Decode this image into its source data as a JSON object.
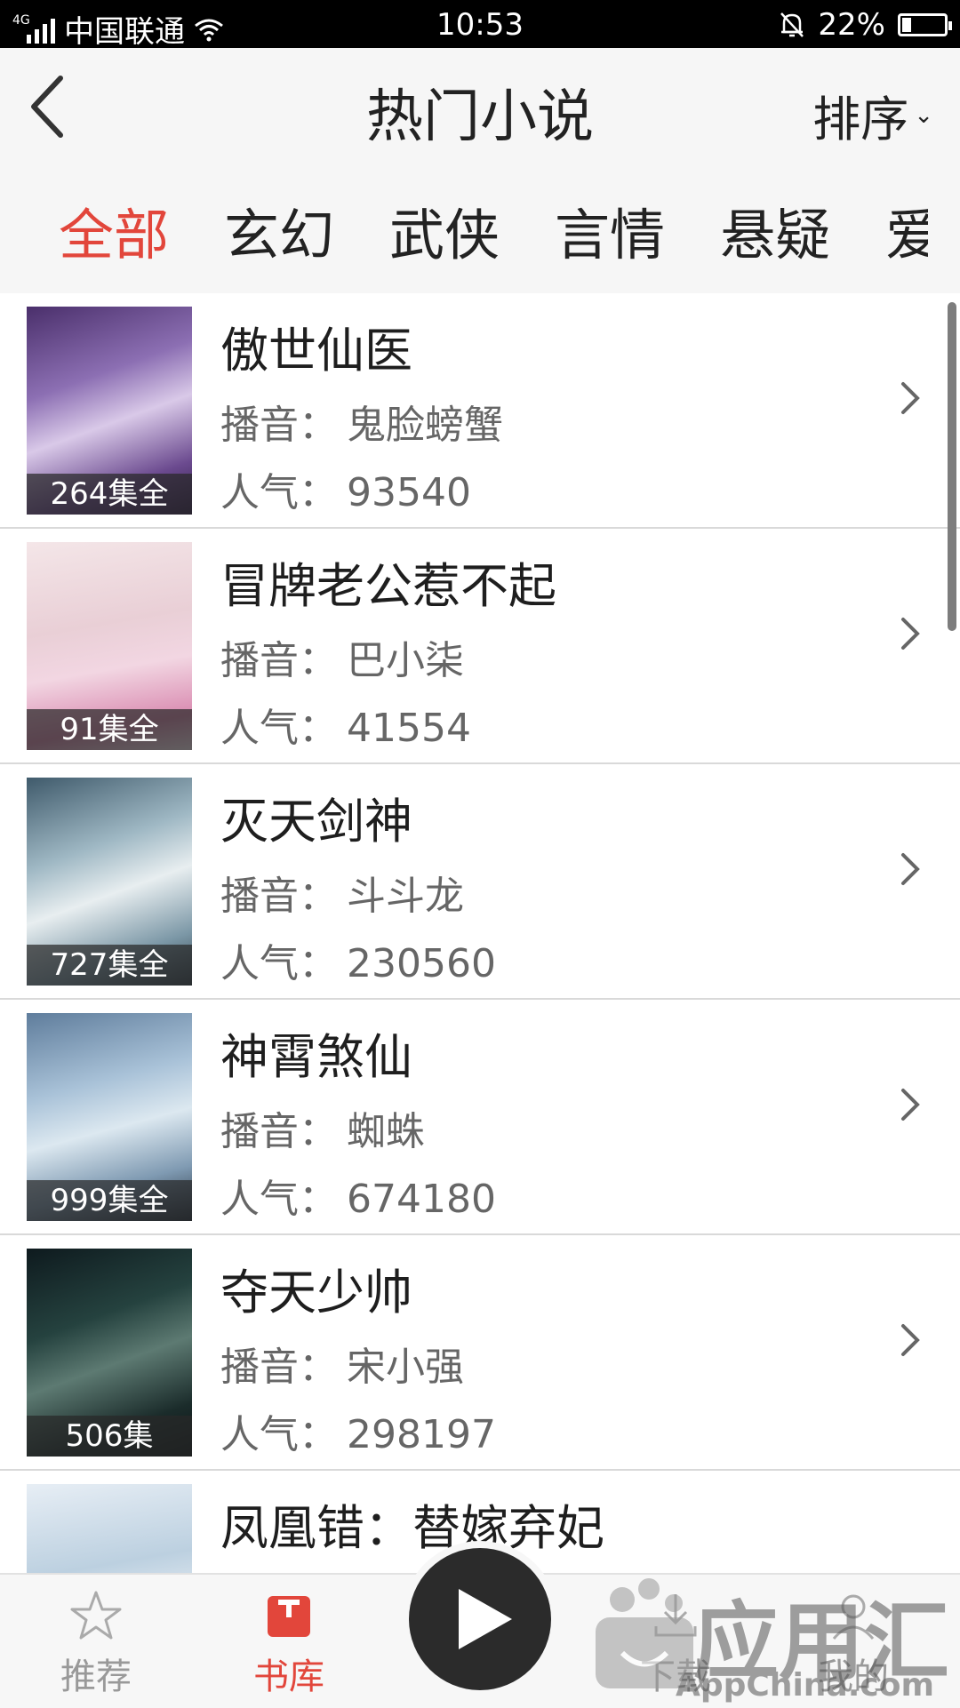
{
  "status": {
    "network": "4G",
    "carrier": "中国联通",
    "time": "10:53",
    "battery": "22%"
  },
  "header": {
    "title": "热门小说",
    "sort_label": "排序"
  },
  "tabs": [
    "全部",
    "玄幻",
    "武侠",
    "言情",
    "悬疑",
    "爱"
  ],
  "labels": {
    "narrator": "播音：",
    "popularity": "人气："
  },
  "books": [
    {
      "title": "傲世仙医",
      "narrator": "鬼脸螃蟹",
      "popularity": "93540",
      "episodes": "264集全"
    },
    {
      "title": "冒牌老公惹不起",
      "narrator": "巴小柒",
      "popularity": "41554",
      "episodes": "91集全"
    },
    {
      "title": "灭天剑神",
      "narrator": "斗斗龙",
      "popularity": "230560",
      "episodes": "727集全"
    },
    {
      "title": "神霄煞仙",
      "narrator": "蜘蛛",
      "popularity": "674180",
      "episodes": "999集全"
    },
    {
      "title": "夺天少帅",
      "narrator": "宋小强",
      "popularity": "298197",
      "episodes": "506集"
    },
    {
      "title": "凤凰错：替嫁弃妃",
      "narrator": "",
      "popularity": "",
      "episodes": ""
    }
  ],
  "nav": {
    "recommend": "推荐",
    "library": "书库",
    "download": "下载",
    "mine": "我的"
  },
  "watermark": {
    "text": "应用汇",
    "sub": "AppChina.com"
  },
  "colors": {
    "accent": "#e2463b",
    "text": "#222222",
    "muted": "#666666"
  }
}
